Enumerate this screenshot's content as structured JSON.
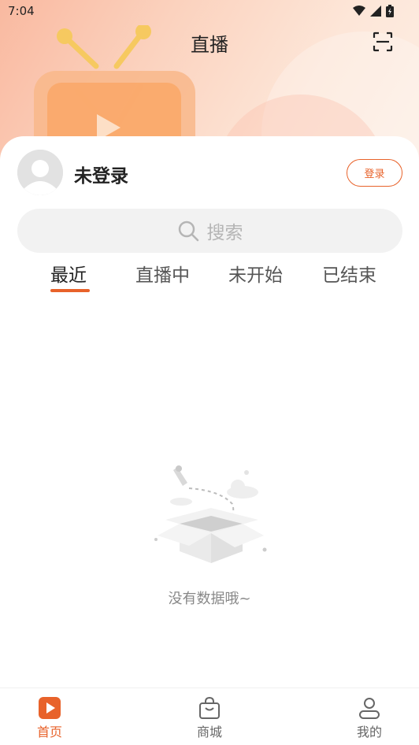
{
  "status_bar": {
    "time": "7:04"
  },
  "header": {
    "title": "直播"
  },
  "user": {
    "name": "未登录",
    "login_label": "登录"
  },
  "search": {
    "placeholder": "搜索"
  },
  "tabs": [
    {
      "label": "最近",
      "active": true
    },
    {
      "label": "直播中",
      "active": false
    },
    {
      "label": "未开始",
      "active": false
    },
    {
      "label": "已结束",
      "active": false
    }
  ],
  "empty_state": {
    "text": "没有数据哦~"
  },
  "bottom_nav": {
    "items": [
      {
        "label": "首页",
        "icon": "play-icon",
        "active": true
      },
      {
        "label": "商城",
        "icon": "shopping-bag-icon",
        "active": false
      },
      {
        "label": "我的",
        "icon": "person-icon",
        "active": false
      }
    ]
  },
  "colors": {
    "accent": "#e8622a",
    "hero_gradient_start": "#f9b9a0",
    "search_bg": "#f2f2f2"
  }
}
